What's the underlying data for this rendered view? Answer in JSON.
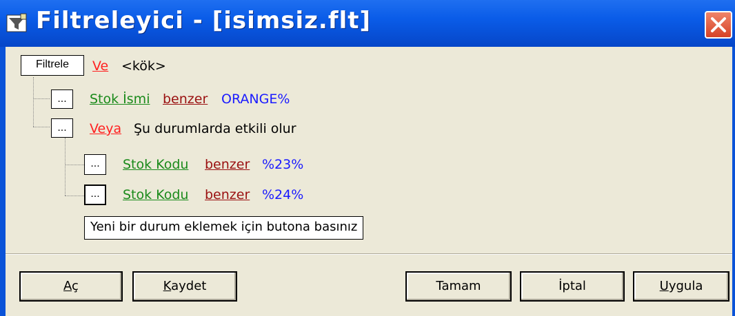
{
  "window": {
    "title": "Filtreleyici - [isimsiz.flt]",
    "close_label": "Close"
  },
  "tree": {
    "root": {
      "button": "Filtrele",
      "operator": "Ve",
      "label": "<kök>"
    },
    "items": [
      {
        "button": "...",
        "field": "Stok İsmi",
        "comparator": "benzer",
        "value": "ORANGE%"
      },
      {
        "button": "...",
        "operator": "Veya",
        "label": "Şu durumlarda etkili olur"
      },
      {
        "button": "...",
        "field": "Stok Kodu",
        "comparator": "benzer",
        "value": "%23%"
      },
      {
        "button": "...",
        "field": "Stok Kodu",
        "comparator": "benzer",
        "value": "%24%"
      }
    ],
    "hint": "Yeni bir durum eklemek için butona basınız"
  },
  "buttons": {
    "open": {
      "accel": "A",
      "rest": "ç"
    },
    "save": {
      "accel": "K",
      "rest": "aydet"
    },
    "ok": "Tamam",
    "cancel": "İptal",
    "apply": {
      "accel": "U",
      "rest": "ygula"
    }
  },
  "colors": {
    "titlebar": "#0a5ce8",
    "client": "#ece9d8",
    "operator": "#ff2020",
    "field": "#1a8a1a",
    "comparator": "#9a1010",
    "value": "#1a1aff"
  },
  "icons": [
    "filter-app-icon",
    "close-icon"
  ]
}
